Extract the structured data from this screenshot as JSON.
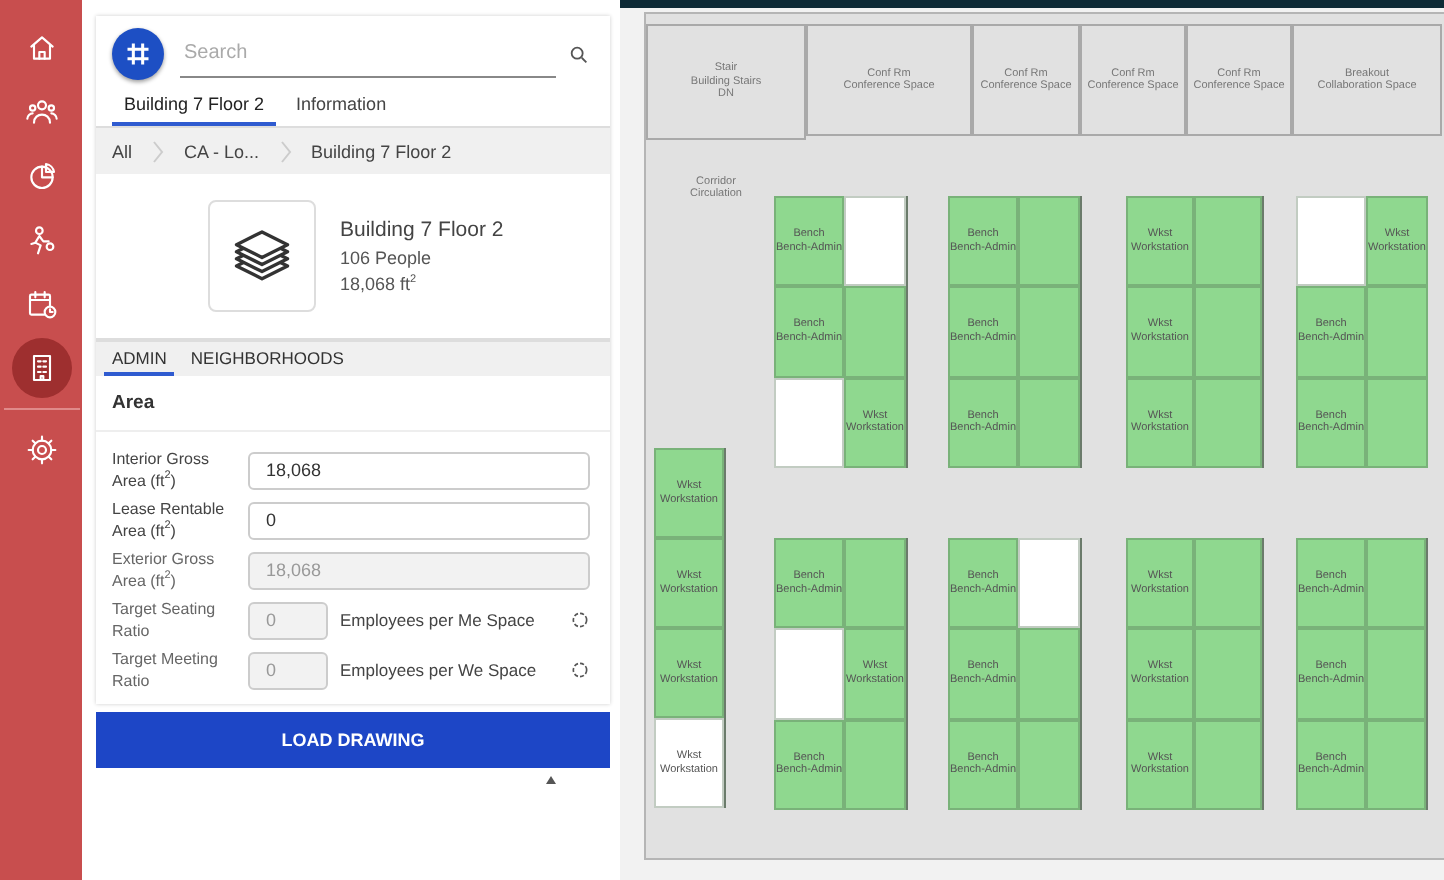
{
  "nav": [
    {
      "selected": false
    },
    {
      "selected": false
    },
    {
      "selected": false
    },
    {
      "selected": false
    },
    {
      "selected": false
    },
    {
      "selected": true
    },
    {
      "selected": false
    }
  ],
  "panel": {
    "search": {
      "placeholder": "Search"
    },
    "tabs": [
      {
        "label": "Building 7 Floor 2",
        "selected": true
      },
      {
        "label": "Information",
        "selected": false
      }
    ],
    "breadcrumb": [
      "All",
      "CA - Lo...",
      "Building 7 Floor 2"
    ],
    "card": {
      "title": "Building 7 Floor 2",
      "people": "106 People",
      "area": "18,068 ft$^{2}$"
    },
    "subtabs": [
      {
        "label": "ADMIN",
        "selected": true
      },
      {
        "label": "NEIGHBORHOODS",
        "selected": false
      }
    ],
    "section": "Area",
    "fields": [
      {
        "kind": "input",
        "label": "Interior Gross Area (ft$^{2}$)",
        "value": "18,068",
        "disabled": false
      },
      {
        "kind": "input",
        "label": "Lease Rentable Area (ft$^{2}$)",
        "value": "0",
        "disabled": false
      },
      {
        "kind": "input",
        "label": "Exterior Gross Area (ft$^{2}$)",
        "value": "18,068",
        "disabled": true
      },
      {
        "kind": "ratio",
        "label": "Target Seating Ratio",
        "value": "0",
        "disabled": true,
        "suffix": "Employees per Me Space"
      },
      {
        "kind": "ratio",
        "label": "Target Meeting Ratio",
        "value": "0",
        "disabled": true,
        "suffix": "Employees per We Space"
      }
    ],
    "button": "LOAD DRAWING"
  },
  "plan": {
    "rooms": [
      {
        "name": "Stair",
        "type": "Building Stairs",
        "note": "DN"
      },
      {
        "name": "Conf Rm",
        "type": "Conference Space"
      },
      {
        "name": "Conf Rm",
        "type": "Conference Space"
      },
      {
        "name": "Conf Rm",
        "type": "Conference Space"
      },
      {
        "name": "Conf Rm",
        "type": "Conference Space"
      },
      {
        "name": "Breakout",
        "type": "Collaboration Space"
      },
      {
        "name": "Corridor",
        "type": "Circulation"
      }
    ],
    "blocks": [
      {
        "rows": [
          [
            {
              "occupied": true,
              "name": "Bench",
              "type": "Bench-Admin"
            },
            {
              "occupied": false
            }
          ],
          [
            {
              "occupied": true,
              "name": "Bench",
              "type": "Bench-Admin"
            },
            {
              "occupied": true
            }
          ],
          [
            {
              "occupied": false
            },
            {
              "occupied": true,
              "name": "Wkst",
              "type": "Workstation"
            }
          ]
        ]
      },
      {
        "rows": [
          [
            {
              "occupied": true,
              "name": "Bench",
              "type": "Bench-Admin"
            },
            {
              "occupied": true
            }
          ],
          [
            {
              "occupied": true,
              "name": "Bench",
              "type": "Bench-Admin"
            },
            {
              "occupied": true
            }
          ],
          [
            {
              "occupied": true,
              "name": "Bench",
              "type": "Bench-Admin"
            },
            {
              "occupied": true
            }
          ]
        ]
      },
      {
        "rows": [
          [
            {
              "occupied": true,
              "name": "Wkst",
              "type": "Workstation"
            },
            {
              "occupied": true
            }
          ],
          [
            {
              "occupied": true,
              "name": "Wkst",
              "type": "Workstation"
            },
            {
              "occupied": true
            }
          ],
          [
            {
              "occupied": true,
              "name": "Wkst",
              "type": "Workstation"
            },
            {
              "occupied": true
            }
          ]
        ]
      },
      {
        "rows": [
          [
            {
              "occupied": false
            },
            {
              "occupied": true,
              "name": "Wkst",
              "type": "Workstation"
            }
          ],
          [
            {
              "occupied": true,
              "name": "Bench",
              "type": "Bench-Admin"
            },
            {
              "occupied": true
            }
          ],
          [
            {
              "occupied": true,
              "name": "Bench",
              "type": "Bench-Admin"
            },
            {
              "occupied": true
            }
          ]
        ]
      },
      {
        "rows": [
          [
            {
              "occupied": true,
              "name": "Wkst",
              "type": "Workstation"
            }
          ],
          [
            {
              "occupied": true,
              "name": "Wkst",
              "type": "Workstation"
            }
          ],
          [
            {
              "occupied": true,
              "name": "Wkst",
              "type": "Workstation"
            }
          ],
          [
            {
              "occupied": false,
              "name": "Wkst",
              "type": "Workstation"
            }
          ]
        ]
      },
      {
        "rows": [
          [
            {
              "occupied": true,
              "name": "Bench",
              "type": "Bench-Admin"
            },
            {
              "occupied": true
            }
          ],
          [
            {
              "occupied": false
            },
            {
              "occupied": true,
              "name": "Wkst",
              "type": "Workstation"
            }
          ],
          [
            {
              "occupied": true,
              "name": "Bench",
              "type": "Bench-Admin"
            },
            {
              "occupied": true
            }
          ]
        ]
      },
      {
        "rows": [
          [
            {
              "occupied": true,
              "name": "Bench",
              "type": "Bench-Admin"
            },
            {
              "occupied": false
            }
          ],
          [
            {
              "occupied": true,
              "name": "Bench",
              "type": "Bench-Admin"
            },
            {
              "occupied": true
            }
          ],
          [
            {
              "occupied": true,
              "name": "Bench",
              "type": "Bench-Admin"
            },
            {
              "occupied": true
            }
          ]
        ]
      },
      {
        "rows": [
          [
            {
              "occupied": true,
              "name": "Wkst",
              "type": "Workstation"
            },
            {
              "occupied": true
            }
          ],
          [
            {
              "occupied": true,
              "name": "Wkst",
              "type": "Workstation"
            },
            {
              "occupied": true
            }
          ],
          [
            {
              "occupied": true,
              "name": "Wkst",
              "type": "Workstation"
            },
            {
              "occupied": true
            }
          ]
        ]
      },
      {
        "rows": [
          [
            {
              "occupied": true,
              "name": "Bench",
              "type": "Bench-Admin"
            },
            {
              "occupied": true
            }
          ],
          [
            {
              "occupied": true,
              "name": "Bench",
              "type": "Bench-Admin"
            },
            {
              "occupied": true
            }
          ],
          [
            {
              "occupied": true,
              "name": "Bench",
              "type": "Bench-Admin"
            },
            {
              "occupied": true
            }
          ]
        ]
      }
    ]
  }
}
